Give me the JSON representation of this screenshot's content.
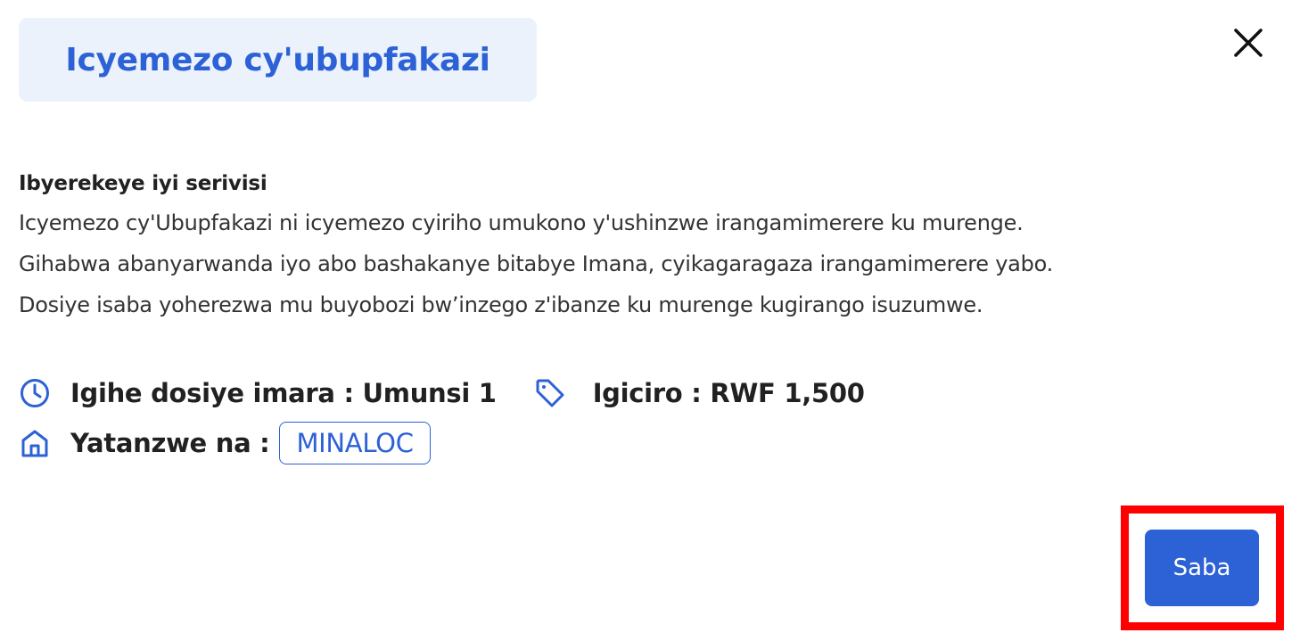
{
  "dialog": {
    "title": "Icyemezo cy'ubupfakazi",
    "close_icon": "close-icon"
  },
  "about": {
    "heading": "Ibyerekeye iyi serivisi",
    "lines": [
      "Icyemezo cy'Ubupfakazi ni icyemezo cyiriho umukono y'ushinzwe irangamimerere ku murenge.",
      "Gihabwa abanyarwanda iyo abo bashakanye bitabye Imana, cyikagaragaza irangamimerere yabo.",
      "Dosiye isaba yoherezwa mu buyobozi bw’inzego z'ibanze ku murenge kugirango isuzumwe."
    ]
  },
  "meta": {
    "processing_icon": "clock-icon",
    "processing_text": "Igihe dosiye imara : Umunsi 1",
    "price_icon": "tag-icon",
    "price_text": "Igiciro : RWF 1,500",
    "provider_icon": "home-icon",
    "provider_label": "Yatanzwe na :",
    "provider_value": "MINALOC"
  },
  "actions": {
    "apply_label": "Saba"
  },
  "colors": {
    "accent": "#2d61d6",
    "title_background": "#ebf2fc",
    "highlight": "#ff0000"
  }
}
